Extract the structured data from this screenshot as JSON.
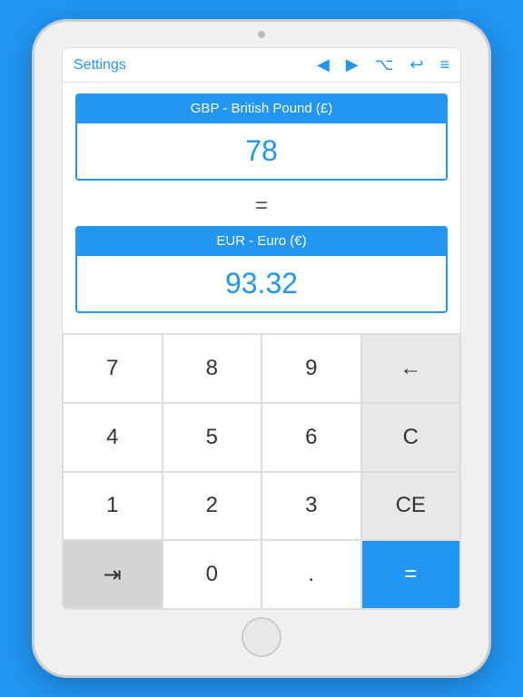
{
  "toolbar": {
    "settings_label": "Settings",
    "back_icon": "◀",
    "forward_icon": "▶",
    "option_icon": "⌥",
    "undo_icon": "↩",
    "menu_icon": "≡"
  },
  "converter": {
    "from_currency_label": "GBP - British Pound (£)",
    "from_value": "78",
    "equals": "=",
    "to_currency_label": "EUR - Euro (€)",
    "to_value": "93.32"
  },
  "keypad": {
    "keys": [
      {
        "label": "7",
        "type": "number"
      },
      {
        "label": "8",
        "type": "number"
      },
      {
        "label": "9",
        "type": "number"
      },
      {
        "label": "←",
        "type": "action-gray"
      },
      {
        "label": "4",
        "type": "number"
      },
      {
        "label": "5",
        "type": "number"
      },
      {
        "label": "6",
        "type": "number"
      },
      {
        "label": "C",
        "type": "action-gray"
      },
      {
        "label": "1",
        "type": "number"
      },
      {
        "label": "2",
        "type": "number"
      },
      {
        "label": "3",
        "type": "number"
      },
      {
        "label": "CE",
        "type": "action-gray"
      },
      {
        "label": "⇥",
        "type": "action-gray2"
      },
      {
        "label": "0",
        "type": "number"
      },
      {
        "label": ".",
        "type": "number"
      },
      {
        "label": "=",
        "type": "action-blue"
      }
    ]
  }
}
